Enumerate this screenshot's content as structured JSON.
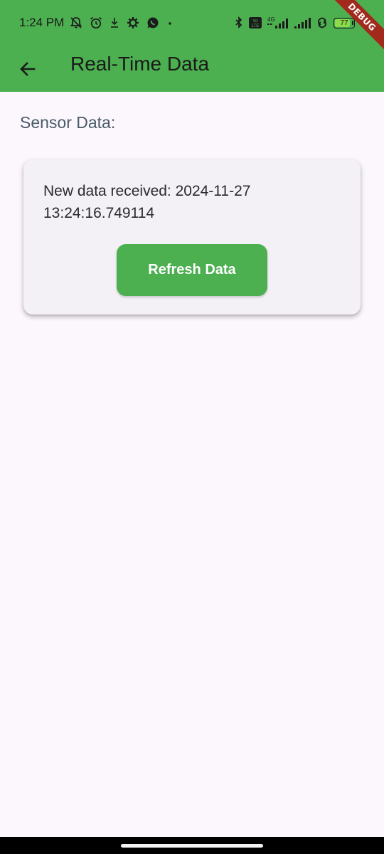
{
  "status_bar": {
    "time": "1:24 PM",
    "battery": "77",
    "network": "4G",
    "volte": "Vo LTE",
    "icons": [
      "mute-icon",
      "alarm-icon",
      "download-icon",
      "settings-icon",
      "whatsapp-icon",
      "dot-icon",
      "bluetooth-icon",
      "volte-icon",
      "signal-icon",
      "signal-icon",
      "hotspot-icon",
      "battery-icon"
    ]
  },
  "app_bar": {
    "title": "Real-Time Data",
    "back_icon": "arrow-back-icon",
    "color": "#4CAF50"
  },
  "debug_banner": {
    "label": "DEBUG",
    "color": "#A22A1C"
  },
  "main": {
    "section_label": "Sensor Data:",
    "card": {
      "message": "New data received: 2024-11-27 13:24:16.749114",
      "button_label": "Refresh Data"
    }
  }
}
